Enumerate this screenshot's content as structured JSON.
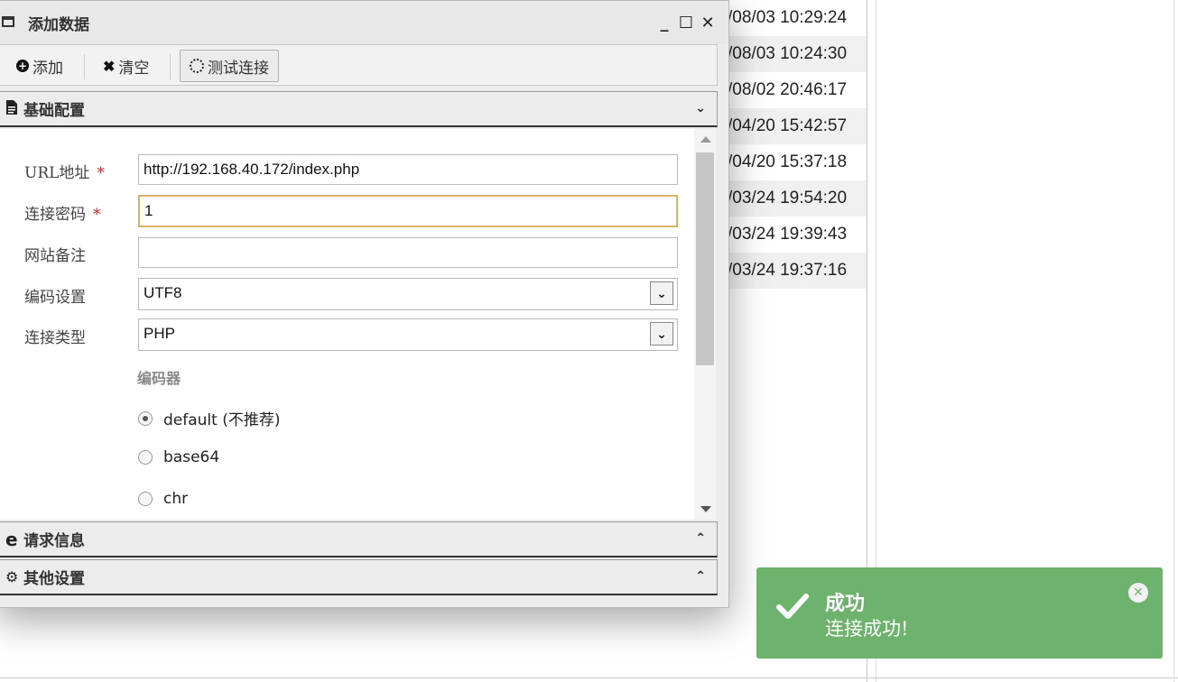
{
  "background": {
    "timestamps": [
      "/08/03 10:29:24",
      "/08/03 10:24:30",
      "/08/02 20:46:17",
      "/04/20 15:42:57",
      "/04/20 15:37:18",
      "/03/24 19:54:20",
      "/03/24 19:39:43",
      "/03/24 19:37:16"
    ]
  },
  "window": {
    "title": "添加数据",
    "minimize": "_",
    "maximize": "☐",
    "close": "✕"
  },
  "toolbar": {
    "add_label": "添加",
    "clear_label": "清空",
    "test_label": "测试连接"
  },
  "sections": {
    "basic": "基础配置",
    "request": "请求信息",
    "other": "其他设置"
  },
  "form": {
    "url_label": "URL地址",
    "url_value": "http://192.168.40.172/index.php",
    "password_label": "连接密码",
    "password_value": "1",
    "note_label": "网站备注",
    "note_value": "",
    "encoding_label": "编码设置",
    "encoding_value": "UTF8",
    "type_label": "连接类型",
    "type_value": "PHP",
    "encoder_heading": "编码器",
    "required_mark": "*",
    "encoders": [
      "default (不推荐)",
      "base64",
      "chr"
    ],
    "encoder_selected": "default (不推荐)"
  },
  "toast": {
    "title": "成功",
    "message": "连接成功!",
    "color": "#6db36d"
  }
}
